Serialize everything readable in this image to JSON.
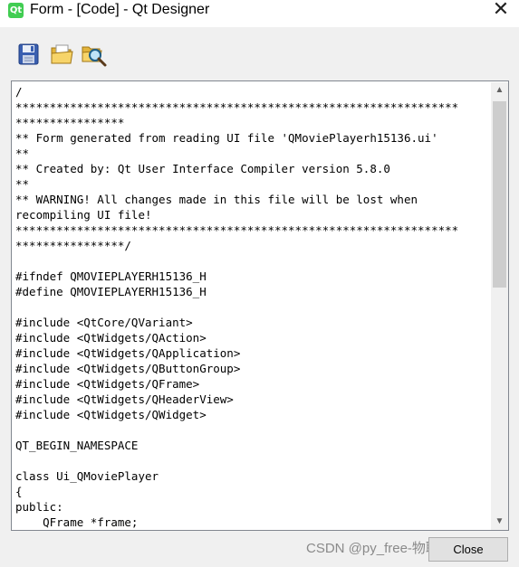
{
  "window": {
    "title": "Form - [Code] - Qt Designer",
    "app_icon_text": "Qt",
    "close_glyph": "✕"
  },
  "toolbar": {
    "buttons": [
      {
        "icon": "save-icon"
      },
      {
        "icon": "open-folder-icon"
      },
      {
        "icon": "preview-icon"
      }
    ]
  },
  "code": {
    "lines": [
      "/",
      "*****************************************************************",
      "****************",
      "** Form generated from reading UI file 'QMoviePlayerh15136.ui'",
      "**",
      "** Created by: Qt User Interface Compiler version 5.8.0",
      "**",
      "** WARNING! All changes made in this file will be lost when",
      "recompiling UI file!",
      "*****************************************************************",
      "****************/",
      "",
      "#ifndef QMOVIEPLAYERH15136_H",
      "#define QMOVIEPLAYERH15136_H",
      "",
      "#include <QtCore/QVariant>",
      "#include <QtWidgets/QAction>",
      "#include <QtWidgets/QApplication>",
      "#include <QtWidgets/QButtonGroup>",
      "#include <QtWidgets/QFrame>",
      "#include <QtWidgets/QHeaderView>",
      "#include <QtWidgets/QWidget>",
      "",
      "QT_BEGIN_NAMESPACE",
      "",
      "class Ui_QMoviePlayer",
      "{",
      "public:",
      "    QFrame *frame;"
    ]
  },
  "scrollbar": {
    "up_glyph": "▲",
    "down_glyph": "▼"
  },
  "footer": {
    "close_label": "Close",
    "watermark": "CSDN @py_free-物联智能"
  },
  "colors": {
    "qt_green": "#41cd52",
    "underline_red": "#e53935"
  }
}
